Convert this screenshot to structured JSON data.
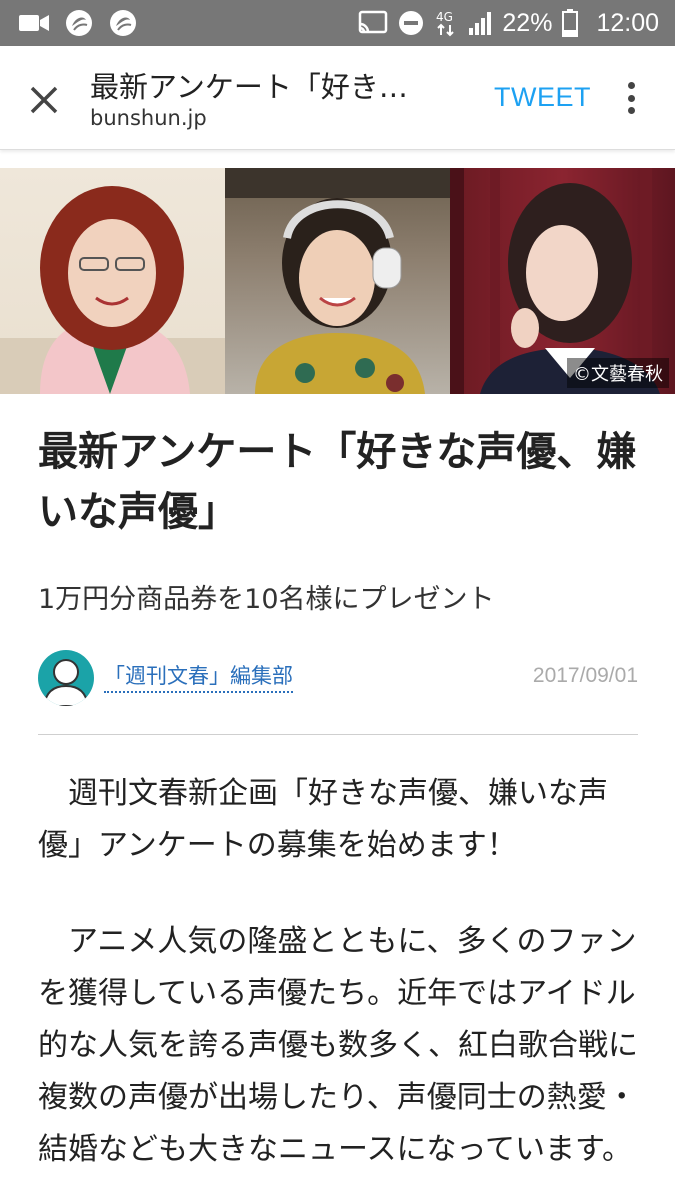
{
  "status_bar": {
    "battery_percent": "22%",
    "time": "12:00",
    "network": "4G",
    "icons": [
      "video-icon",
      "app-icon",
      "app-icon",
      "cast-icon",
      "do-not-disturb-icon",
      "network-4g-icon",
      "signal-icon",
      "battery-icon"
    ]
  },
  "app_bar": {
    "title": "最新アンケート「好き…",
    "domain": "bunshun.jp",
    "tweet_label": "TWEET",
    "accent_color": "#1da1f2"
  },
  "hero": {
    "credit": "©文藝春秋"
  },
  "article": {
    "headline": "最新アンケート「好きな声優、嫌いな声優」",
    "subhead": "1万円分商品券を10名様にプレゼント",
    "author": "「週刊文春」編集部",
    "date": "2017/09/01",
    "paragraphs": [
      "週刊文春新企画「好きな声優、嫌いな声優」アンケートの募集を始めます！",
      "アニメ人気の隆盛とともに、多くのファンを獲得している声優たち。近年ではアイドル的な人気を誇る声優も数多く、紅白歌合戦に複数の声優が出場したり、声優同士の熱愛・結婚なども大きなニュースになっています。"
    ]
  }
}
